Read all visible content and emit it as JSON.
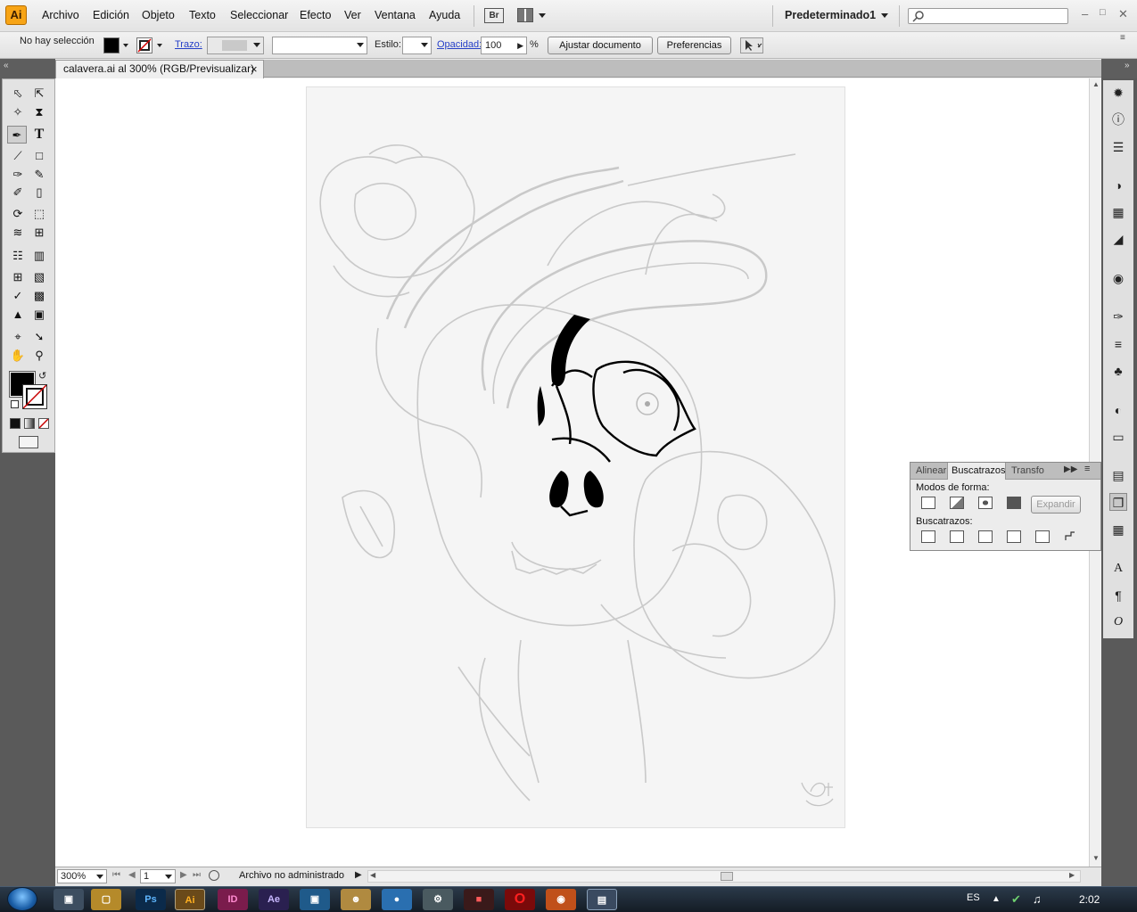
{
  "app": {
    "logo": "Ai"
  },
  "menu": {
    "items": [
      "Archivo",
      "Edición",
      "Objeto",
      "Texto",
      "Seleccionar",
      "Efecto",
      "Ver",
      "Ventana",
      "Ayuda"
    ],
    "bridge_label": "Br",
    "workspace": "Predeterminado1"
  },
  "control": {
    "selection_status": "No hay selección",
    "trazo_label": "Trazo:",
    "estilo_label": "Estilo:",
    "opacidad_label": "Opacidad:",
    "opacidad_value": "100",
    "percent": "%",
    "ajustar_button": "Ajustar documento",
    "preferencias_button": "Preferencias",
    "fill_color": "#000000"
  },
  "document": {
    "tab_title": "calavera.ai al 300% (RGB/Previsualizar)",
    "close_glyph": "×"
  },
  "pathfinder": {
    "tabs": [
      "Alinear",
      "Buscatrazos",
      "Transfo"
    ],
    "active_tab": "Buscatrazos",
    "modos_label": "Modos de forma:",
    "expandir_button": "Expandir",
    "buscatrazos_label": "Buscatrazos:"
  },
  "status": {
    "zoom": "300%",
    "page": "1",
    "file_status": "Archivo no administrado"
  },
  "taskbar": {
    "language": "ES",
    "clock": "2:02",
    "apps": [
      {
        "name": "explorer-icon",
        "label": ""
      },
      {
        "name": "folder-icon",
        "label": ""
      },
      {
        "name": "photoshop-icon",
        "label": "Ps"
      },
      {
        "name": "illustrator-icon",
        "label": "Ai"
      },
      {
        "name": "indesign-icon",
        "label": "ID"
      },
      {
        "name": "aftereffects-icon",
        "label": "Ae"
      },
      {
        "name": "media-icon",
        "label": ""
      },
      {
        "name": "user-icon",
        "label": ""
      },
      {
        "name": "browser-icon",
        "label": ""
      },
      {
        "name": "tool-icon",
        "label": ""
      },
      {
        "name": "app-icon",
        "label": ""
      },
      {
        "name": "opera-icon",
        "label": "O"
      },
      {
        "name": "firefox-icon",
        "label": ""
      },
      {
        "name": "window-icon",
        "label": ""
      }
    ]
  },
  "colors": {
    "accent": "#f7a416",
    "link": "#2640c8",
    "dark": "#5a5a5a"
  }
}
